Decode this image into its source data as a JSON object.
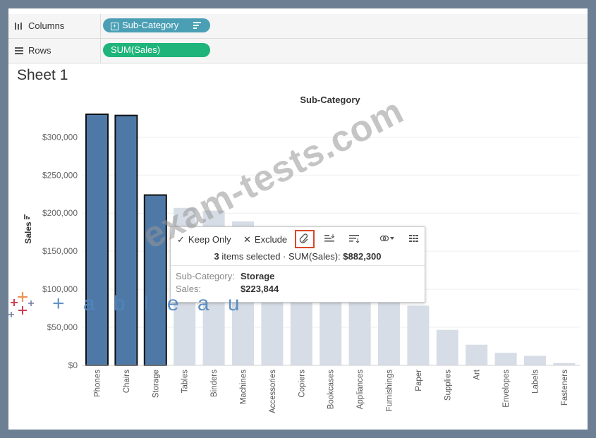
{
  "shelves": {
    "columns": {
      "label": "Columns",
      "pill": "Sub-Category",
      "pill_color": "#4a9fb5"
    },
    "rows": {
      "label": "Rows",
      "pill": "SUM(Sales)",
      "pill_color": "#1eb47a"
    }
  },
  "sheet_title": "Sheet 1",
  "chart_data": {
    "type": "bar",
    "title": "Sub-Category",
    "ylabel": "Sales",
    "ylim": [
      0,
      330000
    ],
    "y_ticks": [
      "$0",
      "$50,000",
      "$100,000",
      "$150,000",
      "$200,000",
      "$250,000",
      "$300,000"
    ],
    "y_tick_values": [
      0,
      50000,
      100000,
      150000,
      200000,
      250000,
      300000
    ],
    "categories": [
      "Phones",
      "Chairs",
      "Storage",
      "Tables",
      "Binders",
      "Machines",
      "Accessories",
      "Copiers",
      "Bookcases",
      "Appliances",
      "Furnishings",
      "Paper",
      "Supplies",
      "Art",
      "Envelopes",
      "Labels",
      "Fasteners"
    ],
    "values": [
      330007,
      328449,
      223844,
      206966,
      203413,
      189239,
      167380,
      149528,
      114880,
      107532,
      91705,
      78479,
      46674,
      27119,
      16476,
      12486,
      3024
    ],
    "selected": [
      "Phones",
      "Chairs",
      "Storage"
    ],
    "selected_color": "#4e79a7",
    "unselected_color": "#d7dde6"
  },
  "tooltip": {
    "keep_only": "Keep Only",
    "exclude": "Exclude",
    "count": "3",
    "summary_rest": "items selected · SUM(Sales):",
    "summary_total": "$882,300",
    "key_subcategory": "Sub-Category:",
    "val_subcategory": "Storage",
    "key_sales": "Sales:",
    "val_sales": "$223,844"
  },
  "watermark": "exam-tests.com",
  "logo": "+ a b l e a u"
}
